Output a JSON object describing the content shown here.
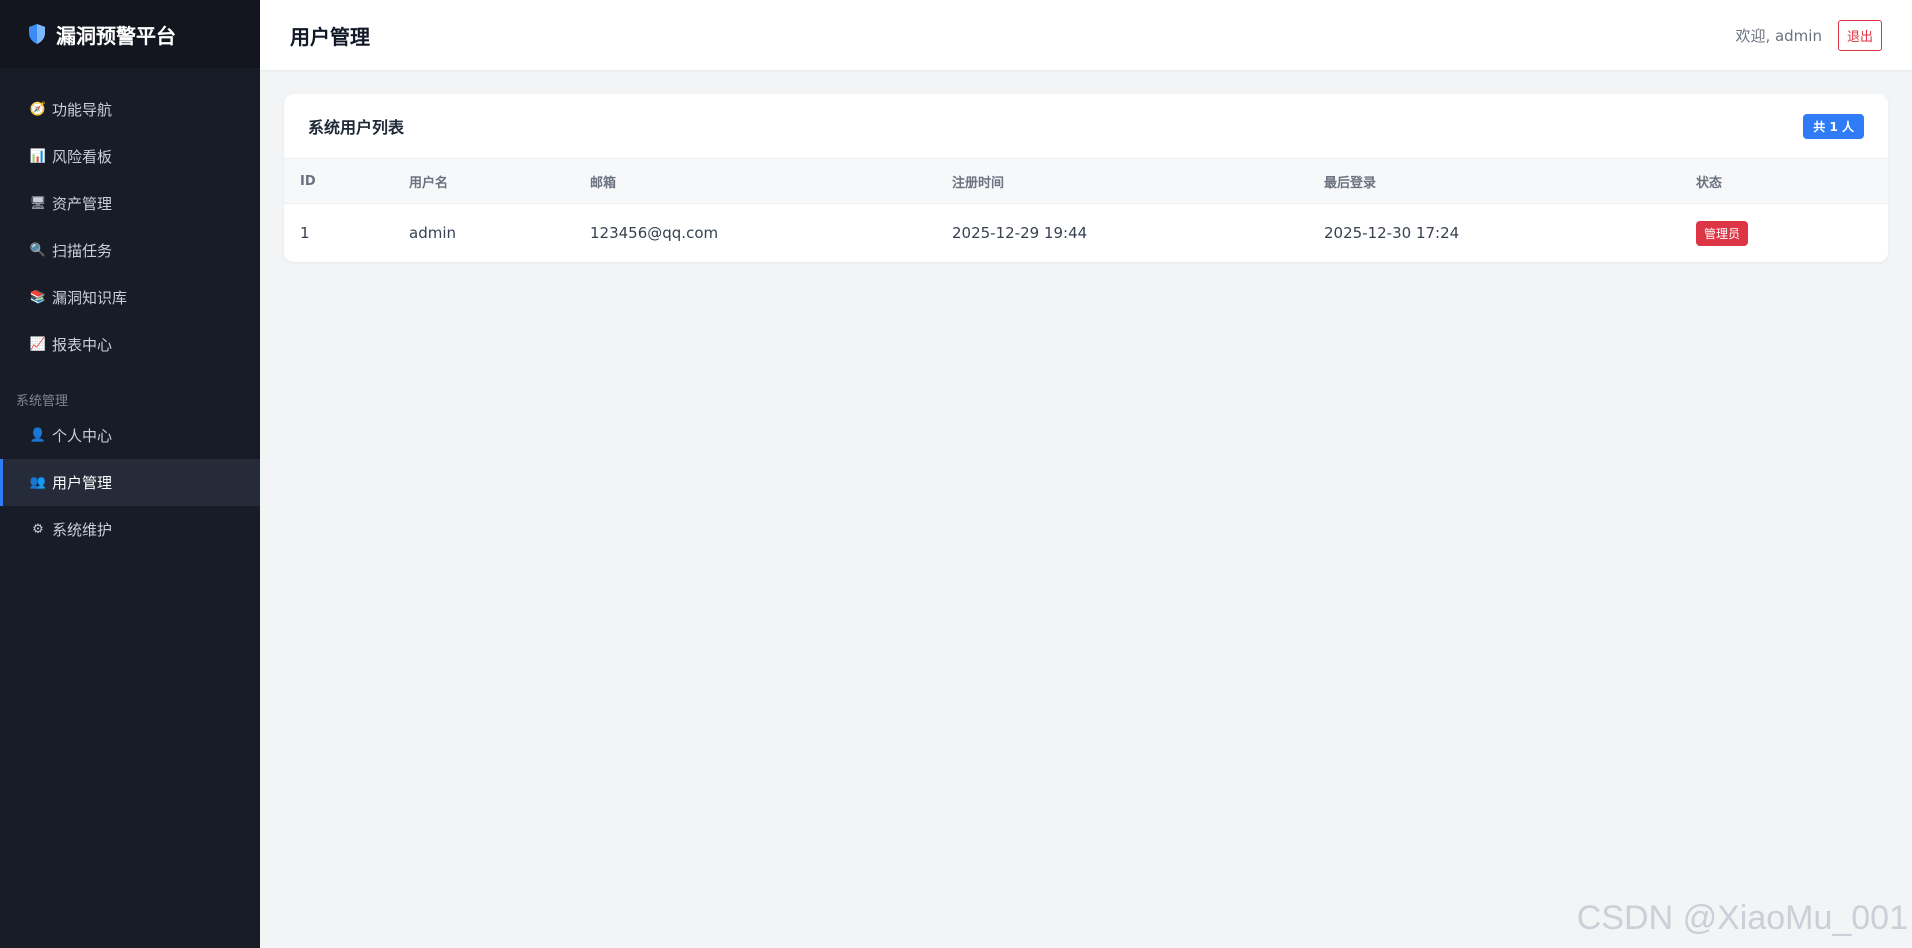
{
  "brand": {
    "title": "漏洞预警平台",
    "icon": "shield-icon"
  },
  "sidebar": {
    "items": [
      {
        "label": "功能导航",
        "icon": "compass-icon",
        "glyph": "🧭"
      },
      {
        "label": "风险看板",
        "icon": "bar-chart-icon",
        "glyph": "📊"
      },
      {
        "label": "资产管理",
        "icon": "computer-icon",
        "glyph": "🖥"
      },
      {
        "label": "扫描任务",
        "icon": "magnifier-icon",
        "glyph": "🔍"
      },
      {
        "label": "漏洞知识库",
        "icon": "books-icon",
        "glyph": "📚"
      },
      {
        "label": "报表中心",
        "icon": "line-chart-icon",
        "glyph": "📈"
      }
    ],
    "section_label": "系统管理",
    "system_items": [
      {
        "label": "个人中心",
        "icon": "user-icon",
        "glyph": "👤"
      },
      {
        "label": "用户管理",
        "icon": "users-icon",
        "glyph": "👥",
        "active": true
      },
      {
        "label": "系统维护",
        "icon": "gear-icon",
        "glyph": "⚙"
      }
    ]
  },
  "header": {
    "title": "用户管理",
    "welcome": "欢迎, admin",
    "logout_label": "退出"
  },
  "card": {
    "title": "系统用户列表",
    "count_badge": "共 1 人"
  },
  "table": {
    "columns": [
      "ID",
      "用户名",
      "邮箱",
      "注册时间",
      "最后登录",
      "状态"
    ],
    "rows": [
      {
        "id": "1",
        "username": "admin",
        "email": "123456@qq.com",
        "registered": "2025-12-29 19:44",
        "last_login": "2025-12-30 17:24",
        "status": "管理员"
      }
    ]
  },
  "watermark": "CSDN @XiaoMu_001",
  "colors": {
    "sidebar_bg": "#181c27",
    "accent": "#2f7cf6",
    "danger": "#dc3545",
    "page_bg": "#f3f4f6"
  }
}
